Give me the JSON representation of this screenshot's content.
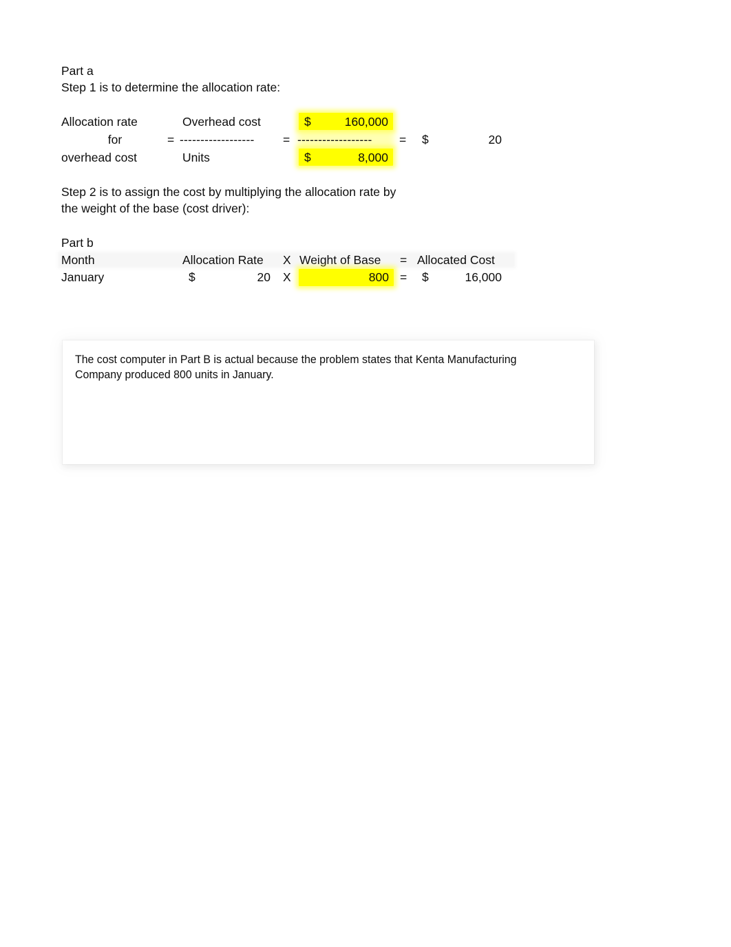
{
  "document": {
    "part_a": {
      "heading": "Part a",
      "step1_text": "Step 1 is to determine the allocation rate:",
      "formula": {
        "label_line1": "Allocation rate",
        "label_line2": "for",
        "label_line3": "overhead cost",
        "equals1": "=",
        "numerator_label": "Overhead cost",
        "divider1": "------------------",
        "denominator_label": "Units",
        "equals2": "=",
        "numerator_currency": "$",
        "numerator_value": "160,000",
        "divider2": "------------------",
        "denominator_currency": "$",
        "denominator_value": "8,000",
        "equals3": "=",
        "result_currency": "$",
        "result_value": "20"
      },
      "step2_text_line1": "Step 2 is to assign the cost by multiplying the allocation rate by",
      "step2_text_line2": "the weight of the base (cost driver):"
    },
    "part_b": {
      "heading": "Part b",
      "table": {
        "headers": {
          "month": "Month",
          "allocation_rate": "Allocation Rate",
          "times": "X",
          "weight_of_base": "Weight of Base",
          "equals": "=",
          "allocated_cost": "Allocated Cost"
        },
        "rows": [
          {
            "month": "January",
            "rate_currency": "$",
            "rate_value": "20",
            "times": "X",
            "weight_value": "800",
            "equals": "=",
            "cost_currency": "$",
            "cost_value": "16,000"
          }
        ]
      }
    },
    "comment_box": {
      "line1": "The cost computer in Part B is actual because the problem states that Kenta Manufacturing",
      "line2": "Company produced 800 units in January."
    }
  },
  "colors": {
    "highlight": "#ffff00",
    "text": "#0d0d0d",
    "page_background": "#ffffff"
  }
}
